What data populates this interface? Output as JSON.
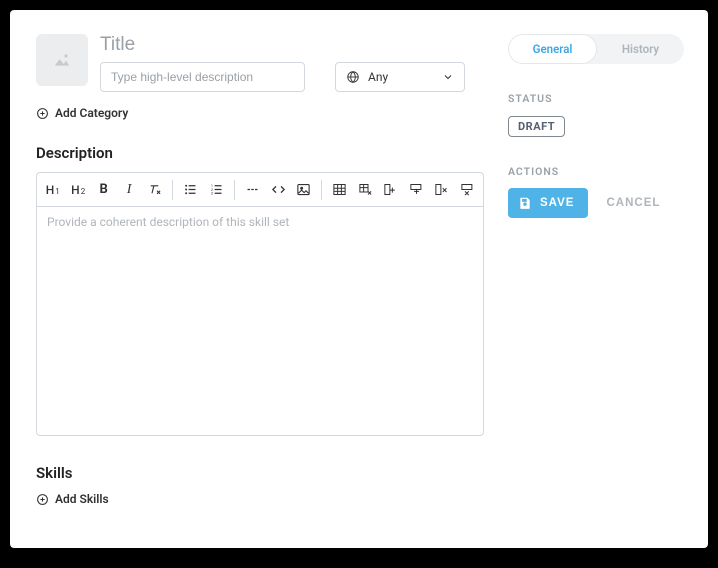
{
  "header": {
    "title_placeholder": "Title",
    "title_value": "",
    "subtitle_placeholder": "Type high-level description",
    "subtitle_value": "",
    "language": {
      "selected": "Any"
    }
  },
  "add_category_label": "Add Category",
  "sections": {
    "description_heading": "Description",
    "skills_heading": "Skills"
  },
  "editor": {
    "placeholder": "Provide a coherent description of this skill set"
  },
  "add_skills_label": "Add Skills",
  "sidebar": {
    "tabs": {
      "general": "General",
      "history": "History",
      "active": "general"
    },
    "status_label": "STATUS",
    "status_value": "DRAFT",
    "actions_label": "ACTIONS",
    "save": "SAVE",
    "cancel": "CANCEL"
  }
}
